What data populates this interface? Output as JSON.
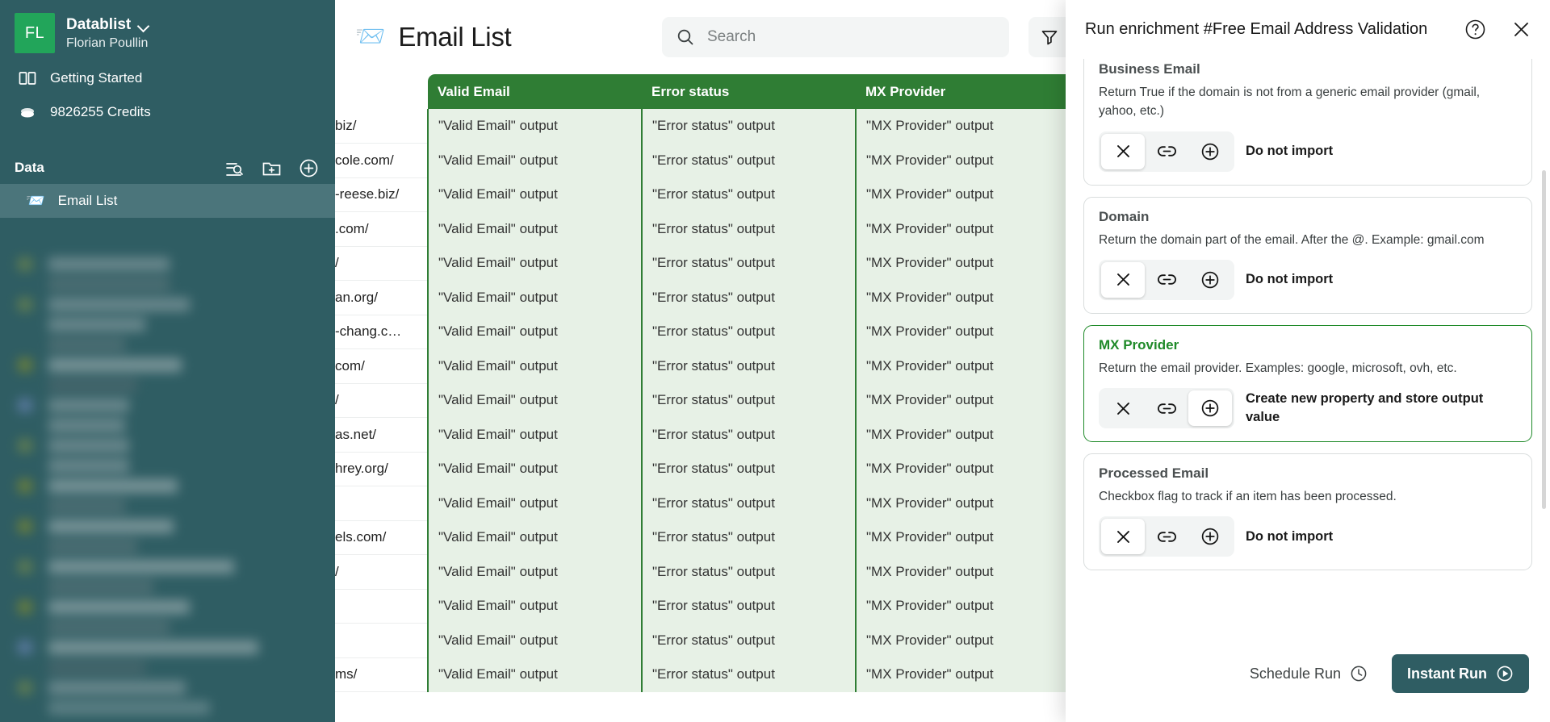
{
  "sidebar": {
    "org": {
      "avatar_initials": "FL",
      "name": "Datablist",
      "user": "Florian Poullin",
      "avatar_color": "#22a55a",
      "chevron_icon": "chevron-down-icon"
    },
    "nav": [
      {
        "icon": "book-icon",
        "label": "Getting Started"
      },
      {
        "icon": "coins-icon",
        "label": "9826255 Credits"
      }
    ],
    "data_section": {
      "title": "Data",
      "actions": [
        {
          "icon": "search-list-icon",
          "name": "search-datasets"
        },
        {
          "icon": "folder-plus-icon",
          "name": "new-folder"
        },
        {
          "icon": "plus-circle-icon",
          "name": "new-dataset"
        }
      ]
    },
    "datasets": [
      {
        "emoji": "📨",
        "label": "Email List",
        "selected": true
      }
    ],
    "background_color": "#2f5d63",
    "selected_item_color": "#4b757b"
  },
  "topbar": {
    "title": "Email List",
    "title_emoji": "📨",
    "search": {
      "icon": "search-icon",
      "value": "",
      "placeholder": "Search"
    },
    "filter": {
      "icon": "filter-icon",
      "chevron_icon": "chevron-down-icon"
    }
  },
  "table": {
    "columns": [
      {
        "key": "url",
        "label": "",
        "header_style": "plain"
      },
      {
        "key": "valid_email",
        "label": "Valid Email",
        "header_style": "green"
      },
      {
        "key": "error_status",
        "label": "Error status",
        "header_style": "green"
      },
      {
        "key": "mx_provider",
        "label": "MX Provider",
        "header_style": "green"
      }
    ],
    "header_color": "#2f7d34",
    "cell_color": "#e7f1e6",
    "rows": [
      {
        "url": "biz/",
        "valid_email": "\"Valid Email\" output",
        "error_status": "\"Error status\" output",
        "mx_provider": "\"MX Provider\" output"
      },
      {
        "url": "cole.com/",
        "valid_email": "\"Valid Email\" output",
        "error_status": "\"Error status\" output",
        "mx_provider": "\"MX Provider\" output"
      },
      {
        "url": "-reese.biz/",
        "valid_email": "\"Valid Email\" output",
        "error_status": "\"Error status\" output",
        "mx_provider": "\"MX Provider\" output"
      },
      {
        "url": ".com/",
        "valid_email": "\"Valid Email\" output",
        "error_status": "\"Error status\" output",
        "mx_provider": "\"MX Provider\" output"
      },
      {
        "url": "/",
        "valid_email": "\"Valid Email\" output",
        "error_status": "\"Error status\" output",
        "mx_provider": "\"MX Provider\" output"
      },
      {
        "url": "an.org/",
        "valid_email": "\"Valid Email\" output",
        "error_status": "\"Error status\" output",
        "mx_provider": "\"MX Provider\" output"
      },
      {
        "url": "-chang.c…",
        "valid_email": "\"Valid Email\" output",
        "error_status": "\"Error status\" output",
        "mx_provider": "\"MX Provider\" output"
      },
      {
        "url": "com/",
        "valid_email": "\"Valid Email\" output",
        "error_status": "\"Error status\" output",
        "mx_provider": "\"MX Provider\" output"
      },
      {
        "url": "/",
        "valid_email": "\"Valid Email\" output",
        "error_status": "\"Error status\" output",
        "mx_provider": "\"MX Provider\" output"
      },
      {
        "url": "as.net/",
        "valid_email": "\"Valid Email\" output",
        "error_status": "\"Error status\" output",
        "mx_provider": "\"MX Provider\" output"
      },
      {
        "url": "hrey.org/",
        "valid_email": "\"Valid Email\" output",
        "error_status": "\"Error status\" output",
        "mx_provider": "\"MX Provider\" output"
      },
      {
        "url": "",
        "valid_email": "\"Valid Email\" output",
        "error_status": "\"Error status\" output",
        "mx_provider": "\"MX Provider\" output"
      },
      {
        "url": "els.com/",
        "valid_email": "\"Valid Email\" output",
        "error_status": "\"Error status\" output",
        "mx_provider": "\"MX Provider\" output"
      },
      {
        "url": "/",
        "valid_email": "\"Valid Email\" output",
        "error_status": "\"Error status\" output",
        "mx_provider": "\"MX Provider\" output"
      },
      {
        "url": "",
        "valid_email": "\"Valid Email\" output",
        "error_status": "\"Error status\" output",
        "mx_provider": "\"MX Provider\" output"
      },
      {
        "url": "",
        "valid_email": "\"Valid Email\" output",
        "error_status": "\"Error status\" output",
        "mx_provider": "\"MX Provider\" output"
      },
      {
        "url": "ms/",
        "valid_email": "\"Valid Email\" output",
        "error_status": "\"Error status\" output",
        "mx_provider": "\"MX Provider\" output"
      }
    ]
  },
  "panel": {
    "title": "Run enrichment #Free Email Address Validation",
    "help_icon": "question-circle-icon",
    "close_icon": "close-icon",
    "accent_color": "#1f8a29",
    "properties": [
      {
        "name": "Business Email",
        "description": "Return True if the domain is not from a generic email provider (gmail, yahoo, etc.)",
        "selected": false,
        "action_label": "Do not import",
        "active_action": "skip",
        "actions": [
          {
            "key": "skip",
            "icon": "close-icon"
          },
          {
            "key": "link",
            "icon": "link-icon"
          },
          {
            "key": "create",
            "icon": "plus-circle-icon"
          }
        ]
      },
      {
        "name": "Domain",
        "description": "Return the domain part of the email. After the @. Example: gmail.com",
        "selected": false,
        "action_label": "Do not import",
        "active_action": "skip",
        "actions": [
          {
            "key": "skip",
            "icon": "close-icon"
          },
          {
            "key": "link",
            "icon": "link-icon"
          },
          {
            "key": "create",
            "icon": "plus-circle-icon"
          }
        ]
      },
      {
        "name": "MX Provider",
        "description": "Return the email provider. Examples: google, microsoft, ovh, etc.",
        "selected": true,
        "action_label": "Create new property and store output value",
        "active_action": "create",
        "actions": [
          {
            "key": "skip",
            "icon": "close-icon"
          },
          {
            "key": "link",
            "icon": "link-icon"
          },
          {
            "key": "create",
            "icon": "plus-circle-icon"
          }
        ]
      },
      {
        "name": "Processed Email",
        "description": "Checkbox flag to track if an item has been processed.",
        "selected": false,
        "action_label": "Do not import",
        "active_action": "skip",
        "actions": [
          {
            "key": "skip",
            "icon": "close-icon"
          },
          {
            "key": "link",
            "icon": "link-icon"
          },
          {
            "key": "create",
            "icon": "plus-circle-icon"
          }
        ]
      }
    ],
    "footer": {
      "schedule_label": "Schedule Run",
      "schedule_icon": "clock-icon",
      "instant_label": "Instant Run",
      "instant_icon": "play-circle-icon",
      "instant_color": "#2f5d63"
    }
  }
}
